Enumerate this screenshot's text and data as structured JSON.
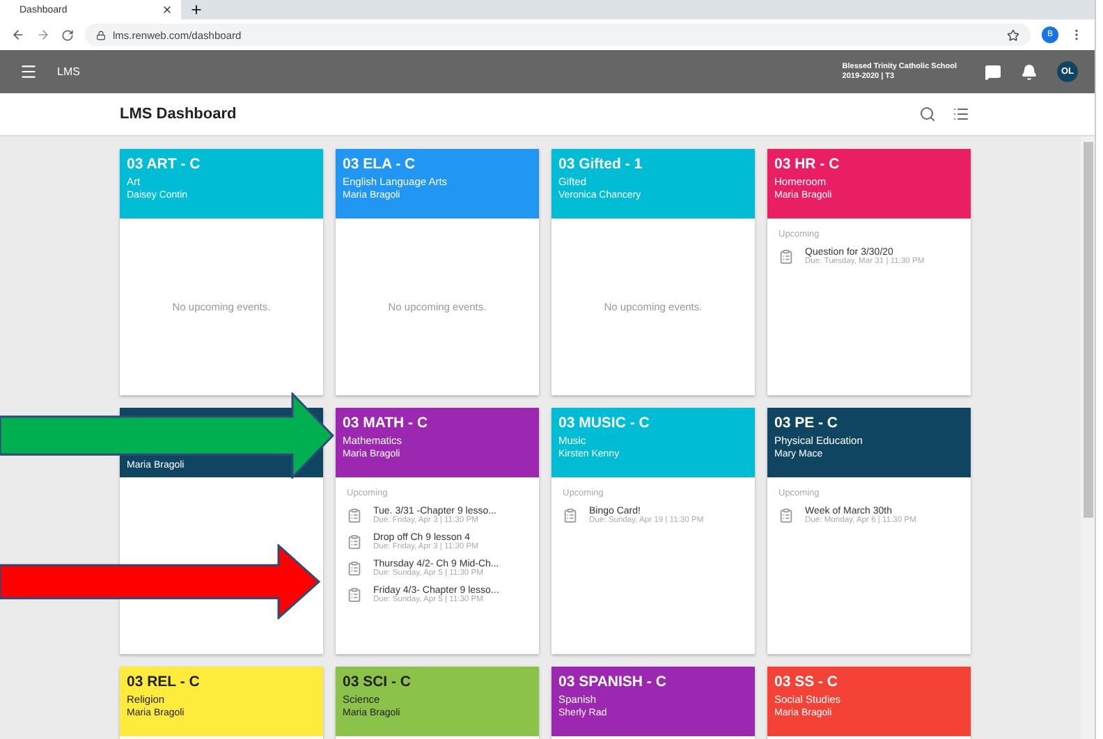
{
  "browser": {
    "tab_title": "Dashboard",
    "url": "lms.renweb.com/dashboard",
    "profile_initial": "B"
  },
  "app_bar": {
    "title": "LMS",
    "school": "Blessed Trinity Catholic School",
    "term": "2019-2020 | T3",
    "avatar": "OL"
  },
  "page_title": "LMS Dashboard",
  "courses": [
    {
      "code": "03 ART - C",
      "subject": "Art",
      "teacher": "Daisey Contin",
      "color": "#00bcd4",
      "empty_text": "No upcoming events."
    },
    {
      "code": "03 ELA - C",
      "subject": "English Language Arts",
      "teacher": "Maria Bragoli",
      "color": "#2196f3",
      "empty_text": "No upcoming events."
    },
    {
      "code": "03 Gifted - 1",
      "subject": "Gifted",
      "teacher": "Veronica Chancery",
      "color": "#00bcd4",
      "empty_text": "No upcoming events."
    },
    {
      "code": "03 HR - C",
      "subject": "Homeroom",
      "teacher": "Maria Bragoli",
      "color": "#e91e63",
      "upcoming_label": "Upcoming",
      "events": [
        {
          "title": "Question for 3/30/20",
          "due": "Due: Tuesday, Mar 31 | 11:30 PM"
        }
      ]
    },
    {
      "teacher": "Maria Bragoli",
      "color": "#0f4560"
    },
    {
      "code": "03 MATH - C",
      "subject": "Mathematics",
      "teacher": "Maria Bragoli",
      "color": "#9c27b0",
      "upcoming_label": "Upcoming",
      "events": [
        {
          "title": "Tue. 3/31 -Chapter 9 lesso...",
          "due": "Due: Friday, Apr 3 | 11:30 PM"
        },
        {
          "title": "Drop off Ch 9 lesson 4",
          "due": "Due: Friday, Apr 3 | 11:30 PM"
        },
        {
          "title": "Thursday 4/2- Ch 9 Mid-Ch...",
          "due": "Due: Sunday, Apr 5 | 11:30 PM"
        },
        {
          "title": "Friday 4/3- Chapter 9 lesso...",
          "due": "Due: Sunday, Apr 5 | 11:30 PM"
        }
      ]
    },
    {
      "code": "03 MUSIC - C",
      "subject": "Music",
      "teacher": "Kirsten Kenny",
      "color": "#00bcd4",
      "upcoming_label": "Upcoming",
      "events": [
        {
          "title": "Bingo Card!",
          "due": "Due: Sunday, Apr 19 | 11:30 PM"
        }
      ]
    },
    {
      "code": "03 PE - C",
      "subject": "Physical Education",
      "teacher": "Mary Mace",
      "color": "#0f4560",
      "upcoming_label": "Upcoming",
      "events": [
        {
          "title": "Week of March 30th",
          "due": "Due: Monday, Apr 6 | 11:30 PM"
        }
      ]
    },
    {
      "code": "03 REL - C",
      "subject": "Religion",
      "teacher": "Maria Bragoli",
      "color": "#ffeb3b"
    },
    {
      "code": "03 SCI - C",
      "subject": "Science",
      "teacher": "Maria Bragoli",
      "color": "#8bc34a"
    },
    {
      "code": "03 SPANISH - C",
      "subject": "Spanish",
      "teacher": "Sherly Rad",
      "color": "#9c27b0"
    },
    {
      "code": "03 SS - C",
      "subject": "Social Studies",
      "teacher": "Maria Bragoli",
      "color": "#f44336"
    }
  ],
  "annotations": [
    {
      "kind": "arrow",
      "color": "#00b050"
    },
    {
      "kind": "arrow",
      "color": "#ff0000"
    }
  ]
}
